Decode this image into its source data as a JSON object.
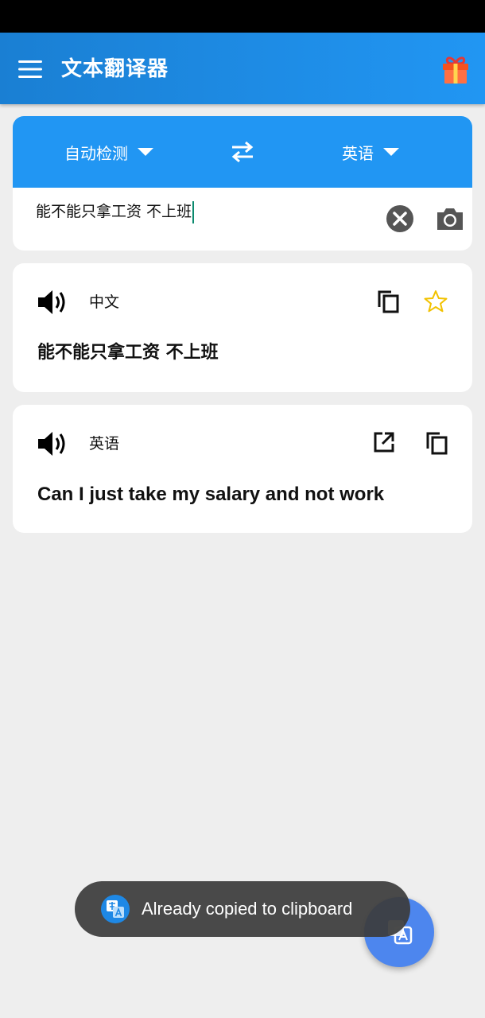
{
  "app_bar": {
    "title": "文本翻译器",
    "icons": {
      "menu": "menu-icon",
      "gift": "gift-icon"
    }
  },
  "languages": {
    "source": "自动检测",
    "target": "英语"
  },
  "input": {
    "text": "能不能只拿工资 不上班"
  },
  "source_result": {
    "language": "中文",
    "text": "能不能只拿工资 不上班"
  },
  "target_result": {
    "language": "英语",
    "text": "Can I just take my salary and not work"
  },
  "toast": {
    "message": "Already copied to clipboard"
  },
  "colors": {
    "app_bar": "#1a7fd3",
    "accent": "#2196f3",
    "star": "#f2c200",
    "fab": "#4d86ee",
    "background": "#eeeeee"
  }
}
